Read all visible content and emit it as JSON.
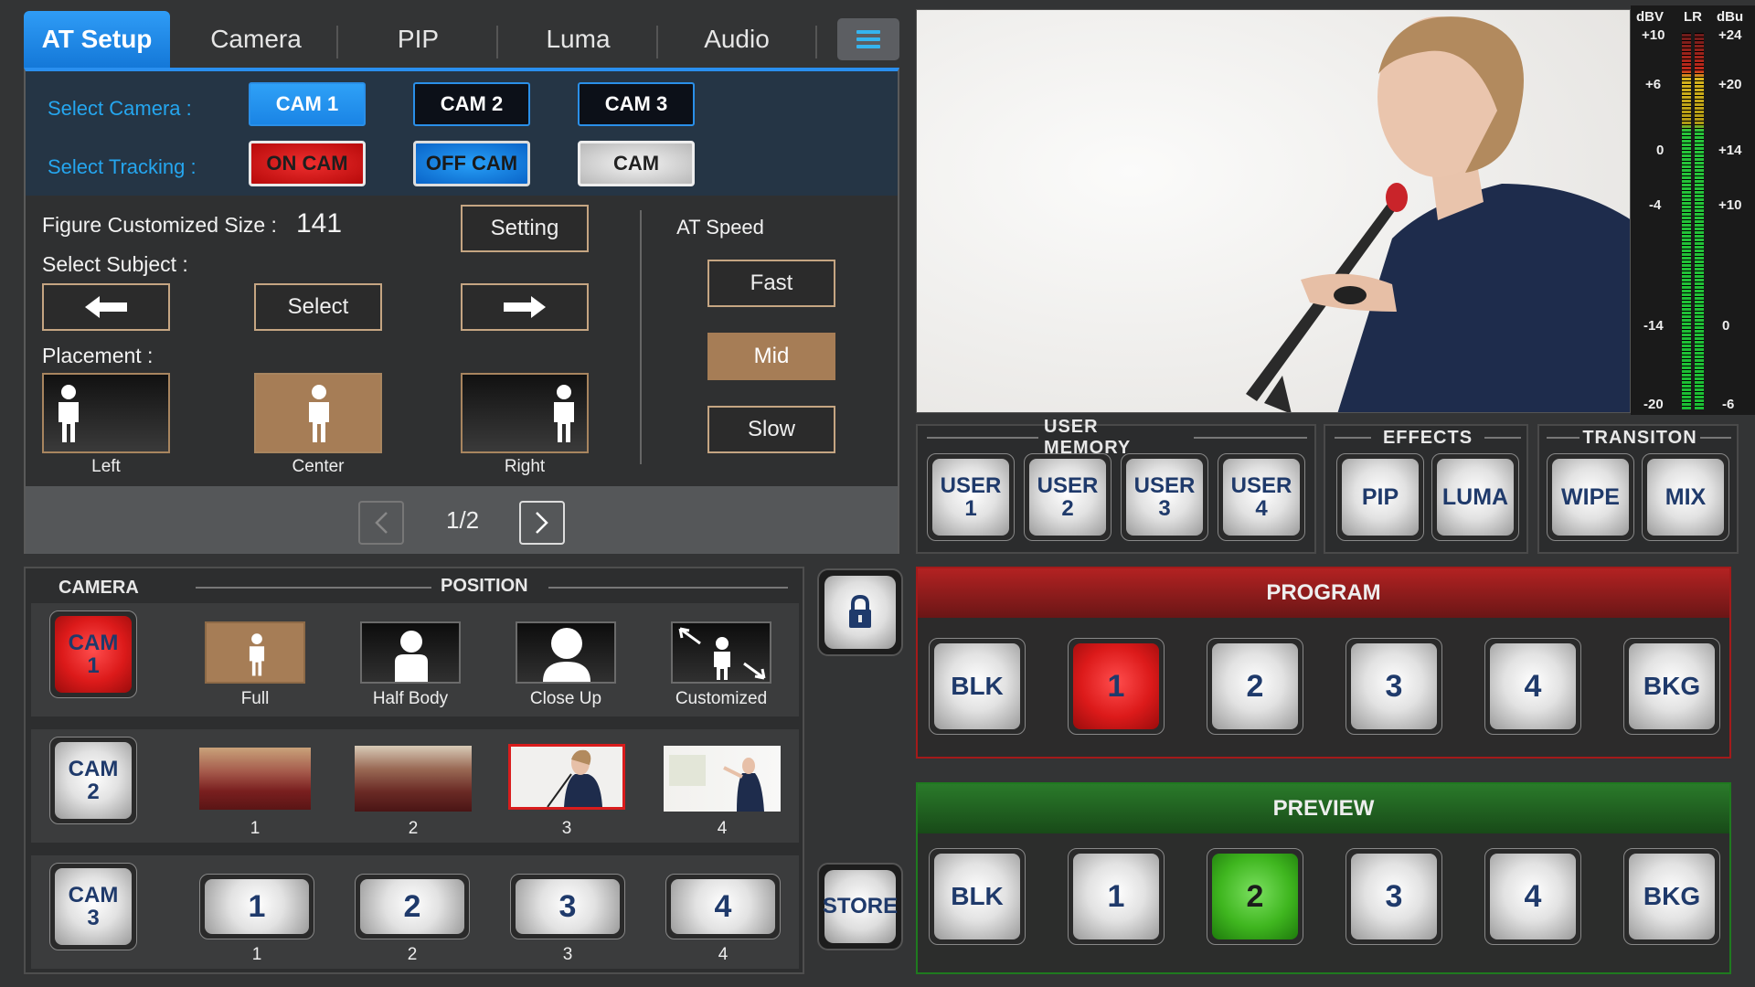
{
  "tabs": [
    "AT Setup",
    "Camera",
    "PIP",
    "Luma",
    "Audio"
  ],
  "at_setup": {
    "select_camera_label": "Select Camera :",
    "cameras": [
      "CAM 1",
      "CAM 2",
      "CAM 3"
    ],
    "selected_camera": "CAM 1",
    "select_tracking_label": "Select Tracking :",
    "tracking": [
      "ON CAM",
      "OFF CAM",
      "CAM"
    ],
    "figure_size_label": "Figure Customized Size :",
    "figure_size_value": "141",
    "setting_label": "Setting",
    "select_subject_label": "Select Subject :",
    "select_label": "Select",
    "placement_label": "Placement :",
    "placements": [
      "Left",
      "Center",
      "Right"
    ],
    "selected_placement": "Center",
    "speed_label": "AT Speed",
    "speeds": [
      "Fast",
      "Mid",
      "Slow"
    ],
    "selected_speed": "Mid",
    "page": "1/2"
  },
  "audio_meter": {
    "left_header": "dBV",
    "mid_header": "LR",
    "right_header": "dBu",
    "left_scale": [
      "+10",
      "+6",
      "0",
      "-4",
      "-14",
      "-20"
    ],
    "right_scale": [
      "+24",
      "+20",
      "+14",
      "+10",
      "0",
      "-6"
    ]
  },
  "user_memory": {
    "title": "USER MEMORY",
    "buttons": [
      "USER 1",
      "USER 2",
      "USER 3",
      "USER 4"
    ]
  },
  "effects": {
    "title": "EFFECTS",
    "buttons": [
      "PIP",
      "LUMA"
    ]
  },
  "transition": {
    "title": "TRANSITON",
    "buttons": [
      "WIPE",
      "MIX"
    ]
  },
  "camera_position": {
    "camera_header": "CAMERA",
    "position_header": "POSITION",
    "rows": [
      {
        "cam": "CAM 1",
        "items": [
          "Full",
          "Half Body",
          "Close Up",
          "Customized"
        ]
      },
      {
        "cam": "CAM 2",
        "items": [
          "1",
          "2",
          "3",
          "4"
        ],
        "selected": "3"
      },
      {
        "cam": "CAM 3",
        "buttons": [
          "1",
          "2",
          "3",
          "4"
        ],
        "items": [
          "1",
          "2",
          "3",
          "4"
        ]
      }
    ]
  },
  "store_label": "STORE",
  "program": {
    "title": "PROGRAM",
    "buttons": [
      "BLK",
      "1",
      "2",
      "3",
      "4",
      "BKG"
    ],
    "active": "1",
    "accent": "#e0141a"
  },
  "preview": {
    "title": "PREVIEW",
    "buttons": [
      "BLK",
      "1",
      "2",
      "3",
      "4",
      "BKG"
    ],
    "active": "2",
    "accent": "#3db81f"
  },
  "colors": {
    "accent_blue": "#2a8fef",
    "gold": "#a67d56"
  },
  "icons": [
    "menu-icon",
    "lock-icon",
    "arrow-left-icon",
    "arrow-right-icon",
    "chevron-left-icon",
    "chevron-right-icon",
    "person-icon",
    "expand-arrows-icon"
  ]
}
